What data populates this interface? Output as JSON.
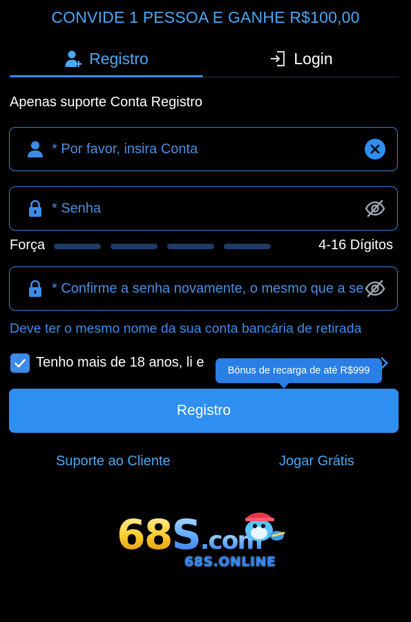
{
  "banner": "CONVIDE 1 PESSOA E GANHE R$100,00",
  "tabs": {
    "register": "Registro",
    "login": "Login"
  },
  "support_note": "Apenas suporte Conta Registro",
  "fields": {
    "account_placeholder": "* Por favor, insira Conta",
    "password_placeholder": "* Senha",
    "confirm_placeholder": "* Confirme a senha novamente, o mesmo que a senha"
  },
  "strength": {
    "label": "Força",
    "digits": "4-16 Dígitos"
  },
  "hint": "Deve ter o mesmo nome da sua conta bancária de retirada",
  "agree": {
    "text": "Tenho mais de 18 anos, li e",
    "checked": true
  },
  "tooltip": "Bónus de recarga de até R$999",
  "submit_label": "Registro",
  "links": {
    "support": "Suporte ao Cliente",
    "free_play": "Jogar Grátis"
  },
  "logo": {
    "digits": "68",
    "letter": "S",
    "suffix": ".com",
    "subtitle": "68S.ONLINE"
  },
  "colors": {
    "accent": "#2f8ff0",
    "link": "#4aa8f5",
    "background": "#000000"
  },
  "icons": {
    "register_tab": "add-user-icon",
    "login_tab": "login-icon",
    "account": "user-icon",
    "password": "lock-icon",
    "clear": "clear-icon",
    "visibility": "eye-off-icon"
  }
}
